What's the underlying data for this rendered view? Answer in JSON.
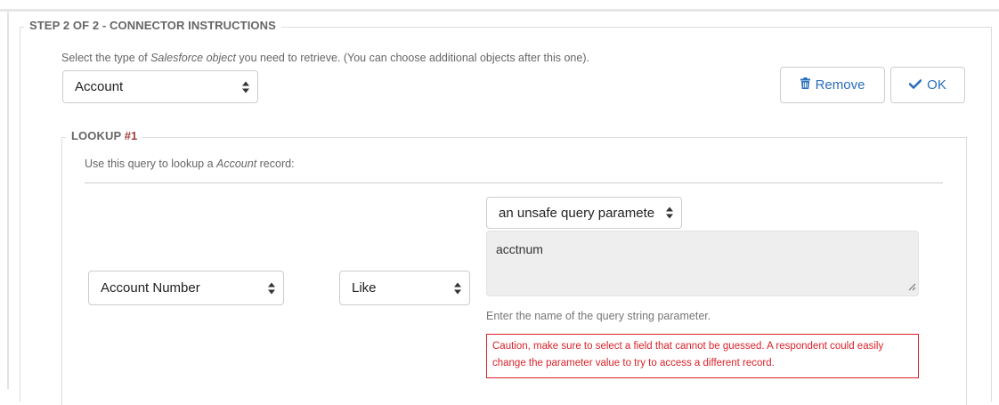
{
  "step": {
    "legend": "STEP 2 OF 2 - CONNECTOR INSTRUCTIONS"
  },
  "intro": {
    "text_before": "Select the type of ",
    "text_em": "Salesforce object",
    "text_after": " you need to retrieve. (You can choose additional objects after this one)."
  },
  "object_select": {
    "value": "Account"
  },
  "buttons": {
    "remove_label": "Remove",
    "ok_label": "OK"
  },
  "lookup": {
    "legend_label": "LOOKUP ",
    "legend_number": "#1",
    "desc_before": "Use this query to lookup a ",
    "desc_em": "Account",
    "desc_after": " record:"
  },
  "field_select": {
    "value": "Account Number"
  },
  "operator_select": {
    "value": "Like"
  },
  "source_select": {
    "value": "an unsafe query paramete"
  },
  "parameter_input": {
    "value": "acctnum"
  },
  "help_text": "Enter the name of the query string parameter.",
  "caution_text": "Caution, make sure to select a field that cannot be guessed. A respondent could easily change the parameter value to try to access a different record.",
  "colors": {
    "link_blue": "#2a6ebb",
    "caution_red": "#d9232a",
    "lookup_number": "#a04040"
  },
  "icons": {
    "remove": "trash-icon",
    "ok": "check-icon",
    "select": "sort-arrows-icon",
    "resize": "resize-grip-icon"
  }
}
